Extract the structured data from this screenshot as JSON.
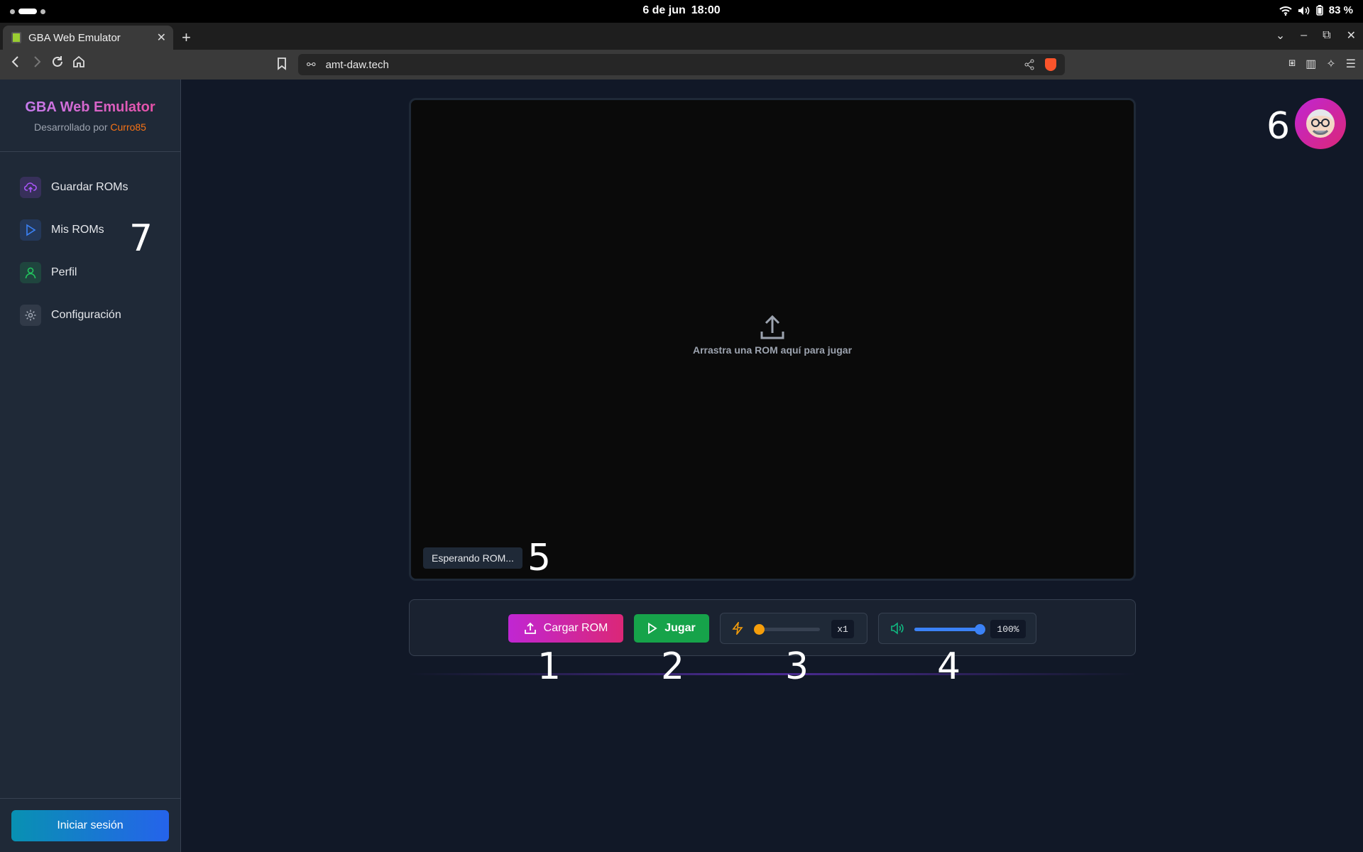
{
  "os": {
    "date": "6 de jun",
    "time": "18:00",
    "battery": "83 %"
  },
  "browser": {
    "tab_title": "GBA Web Emulator",
    "new_tab": "+",
    "url": "amt-daw.tech"
  },
  "sidebar": {
    "brand_title": "GBA Web Emulator",
    "brand_sub_prefix": "Desarrollado por",
    "brand_author": "Curro85",
    "items": [
      {
        "label": "Guardar ROMs",
        "icon": "cloud-upload-icon"
      },
      {
        "label": "Mis ROMs",
        "icon": "play-icon"
      },
      {
        "label": "Perfil",
        "icon": "user-icon"
      },
      {
        "label": "Configuración",
        "icon": "gear-icon"
      }
    ],
    "login_label": "Iniciar sesión"
  },
  "screen": {
    "drop_text": "Arrastra una ROM aquí para jugar",
    "status": "Esperando ROM..."
  },
  "controls": {
    "load_label": "Cargar ROM",
    "play_label": "Jugar",
    "speed_value": "x1",
    "speed_level": 0.05,
    "volume_value": "100%",
    "volume_level": 1.0
  },
  "markers": [
    "1",
    "2",
    "3",
    "4",
    "5",
    "6",
    "7"
  ],
  "colors": {
    "accent_purple": "#a855f7",
    "accent_pink": "#db2777",
    "play_green": "#16a34a",
    "speed_orange": "#f59e0b",
    "volume_blue": "#3b82f6",
    "login_blue": "#2563eb"
  }
}
